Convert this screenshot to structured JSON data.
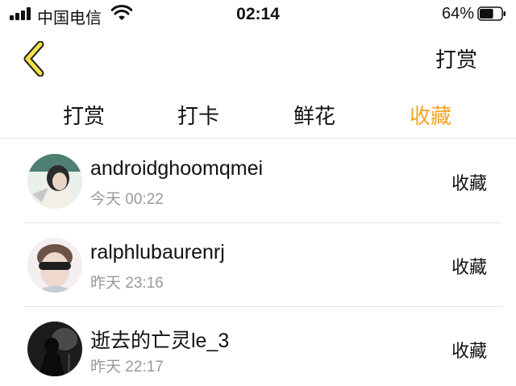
{
  "status_bar": {
    "carrier": "中国电信",
    "time": "02:14",
    "battery": "64%",
    "battery_level": 0.64
  },
  "nav": {
    "back_icon": "chevron-left-icon",
    "action_label": "打赏",
    "accent_color": "#f5e04a"
  },
  "tabs": [
    {
      "label": "打赏",
      "active": false
    },
    {
      "label": "打卡",
      "active": false
    },
    {
      "label": "鲜花",
      "active": false
    },
    {
      "label": "收藏",
      "active": true
    }
  ],
  "active_color": "#f5a523",
  "list": [
    {
      "name": "androidghoomqmei",
      "time": "今天 00:22",
      "action": "收藏"
    },
    {
      "name": "ralphlubaurenrj",
      "time": "昨天 23:16",
      "action": "收藏"
    },
    {
      "name": "逝去的亡灵le_3",
      "time": "昨天 22:17",
      "action": "收藏"
    }
  ]
}
